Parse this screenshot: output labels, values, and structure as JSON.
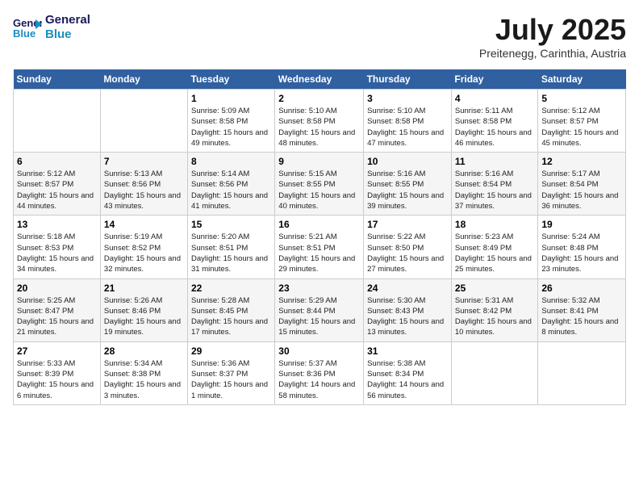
{
  "header": {
    "logo_line1": "General",
    "logo_line2": "Blue",
    "month": "July 2025",
    "location": "Preitenegg, Carinthia, Austria"
  },
  "weekdays": [
    "Sunday",
    "Monday",
    "Tuesday",
    "Wednesday",
    "Thursday",
    "Friday",
    "Saturday"
  ],
  "weeks": [
    [
      {
        "day": "",
        "info": ""
      },
      {
        "day": "",
        "info": ""
      },
      {
        "day": "1",
        "sunrise": "Sunrise: 5:09 AM",
        "sunset": "Sunset: 8:58 PM",
        "daylight": "Daylight: 15 hours and 49 minutes."
      },
      {
        "day": "2",
        "sunrise": "Sunrise: 5:10 AM",
        "sunset": "Sunset: 8:58 PM",
        "daylight": "Daylight: 15 hours and 48 minutes."
      },
      {
        "day": "3",
        "sunrise": "Sunrise: 5:10 AM",
        "sunset": "Sunset: 8:58 PM",
        "daylight": "Daylight: 15 hours and 47 minutes."
      },
      {
        "day": "4",
        "sunrise": "Sunrise: 5:11 AM",
        "sunset": "Sunset: 8:58 PM",
        "daylight": "Daylight: 15 hours and 46 minutes."
      },
      {
        "day": "5",
        "sunrise": "Sunrise: 5:12 AM",
        "sunset": "Sunset: 8:57 PM",
        "daylight": "Daylight: 15 hours and 45 minutes."
      }
    ],
    [
      {
        "day": "6",
        "sunrise": "Sunrise: 5:12 AM",
        "sunset": "Sunset: 8:57 PM",
        "daylight": "Daylight: 15 hours and 44 minutes."
      },
      {
        "day": "7",
        "sunrise": "Sunrise: 5:13 AM",
        "sunset": "Sunset: 8:56 PM",
        "daylight": "Daylight: 15 hours and 43 minutes."
      },
      {
        "day": "8",
        "sunrise": "Sunrise: 5:14 AM",
        "sunset": "Sunset: 8:56 PM",
        "daylight": "Daylight: 15 hours and 41 minutes."
      },
      {
        "day": "9",
        "sunrise": "Sunrise: 5:15 AM",
        "sunset": "Sunset: 8:55 PM",
        "daylight": "Daylight: 15 hours and 40 minutes."
      },
      {
        "day": "10",
        "sunrise": "Sunrise: 5:16 AM",
        "sunset": "Sunset: 8:55 PM",
        "daylight": "Daylight: 15 hours and 39 minutes."
      },
      {
        "day": "11",
        "sunrise": "Sunrise: 5:16 AM",
        "sunset": "Sunset: 8:54 PM",
        "daylight": "Daylight: 15 hours and 37 minutes."
      },
      {
        "day": "12",
        "sunrise": "Sunrise: 5:17 AM",
        "sunset": "Sunset: 8:54 PM",
        "daylight": "Daylight: 15 hours and 36 minutes."
      }
    ],
    [
      {
        "day": "13",
        "sunrise": "Sunrise: 5:18 AM",
        "sunset": "Sunset: 8:53 PM",
        "daylight": "Daylight: 15 hours and 34 minutes."
      },
      {
        "day": "14",
        "sunrise": "Sunrise: 5:19 AM",
        "sunset": "Sunset: 8:52 PM",
        "daylight": "Daylight: 15 hours and 32 minutes."
      },
      {
        "day": "15",
        "sunrise": "Sunrise: 5:20 AM",
        "sunset": "Sunset: 8:51 PM",
        "daylight": "Daylight: 15 hours and 31 minutes."
      },
      {
        "day": "16",
        "sunrise": "Sunrise: 5:21 AM",
        "sunset": "Sunset: 8:51 PM",
        "daylight": "Daylight: 15 hours and 29 minutes."
      },
      {
        "day": "17",
        "sunrise": "Sunrise: 5:22 AM",
        "sunset": "Sunset: 8:50 PM",
        "daylight": "Daylight: 15 hours and 27 minutes."
      },
      {
        "day": "18",
        "sunrise": "Sunrise: 5:23 AM",
        "sunset": "Sunset: 8:49 PM",
        "daylight": "Daylight: 15 hours and 25 minutes."
      },
      {
        "day": "19",
        "sunrise": "Sunrise: 5:24 AM",
        "sunset": "Sunset: 8:48 PM",
        "daylight": "Daylight: 15 hours and 23 minutes."
      }
    ],
    [
      {
        "day": "20",
        "sunrise": "Sunrise: 5:25 AM",
        "sunset": "Sunset: 8:47 PM",
        "daylight": "Daylight: 15 hours and 21 minutes."
      },
      {
        "day": "21",
        "sunrise": "Sunrise: 5:26 AM",
        "sunset": "Sunset: 8:46 PM",
        "daylight": "Daylight: 15 hours and 19 minutes."
      },
      {
        "day": "22",
        "sunrise": "Sunrise: 5:28 AM",
        "sunset": "Sunset: 8:45 PM",
        "daylight": "Daylight: 15 hours and 17 minutes."
      },
      {
        "day": "23",
        "sunrise": "Sunrise: 5:29 AM",
        "sunset": "Sunset: 8:44 PM",
        "daylight": "Daylight: 15 hours and 15 minutes."
      },
      {
        "day": "24",
        "sunrise": "Sunrise: 5:30 AM",
        "sunset": "Sunset: 8:43 PM",
        "daylight": "Daylight: 15 hours and 13 minutes."
      },
      {
        "day": "25",
        "sunrise": "Sunrise: 5:31 AM",
        "sunset": "Sunset: 8:42 PM",
        "daylight": "Daylight: 15 hours and 10 minutes."
      },
      {
        "day": "26",
        "sunrise": "Sunrise: 5:32 AM",
        "sunset": "Sunset: 8:41 PM",
        "daylight": "Daylight: 15 hours and 8 minutes."
      }
    ],
    [
      {
        "day": "27",
        "sunrise": "Sunrise: 5:33 AM",
        "sunset": "Sunset: 8:39 PM",
        "daylight": "Daylight: 15 hours and 6 minutes."
      },
      {
        "day": "28",
        "sunrise": "Sunrise: 5:34 AM",
        "sunset": "Sunset: 8:38 PM",
        "daylight": "Daylight: 15 hours and 3 minutes."
      },
      {
        "day": "29",
        "sunrise": "Sunrise: 5:36 AM",
        "sunset": "Sunset: 8:37 PM",
        "daylight": "Daylight: 15 hours and 1 minute."
      },
      {
        "day": "30",
        "sunrise": "Sunrise: 5:37 AM",
        "sunset": "Sunset: 8:36 PM",
        "daylight": "Daylight: 14 hours and 58 minutes."
      },
      {
        "day": "31",
        "sunrise": "Sunrise: 5:38 AM",
        "sunset": "Sunset: 8:34 PM",
        "daylight": "Daylight: 14 hours and 56 minutes."
      },
      {
        "day": "",
        "info": ""
      },
      {
        "day": "",
        "info": ""
      }
    ]
  ]
}
